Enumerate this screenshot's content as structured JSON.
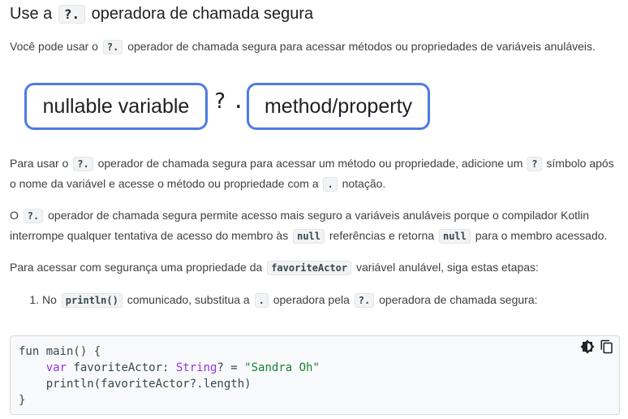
{
  "heading": {
    "pre": "Use a",
    "code": "?.",
    "post": "operadora de chamada segura"
  },
  "intro": {
    "pre": "Você pode usar o",
    "code": "?.",
    "post": "operador de chamada segura para acessar métodos ou propriedades de variáveis anuláveis."
  },
  "diagram": {
    "left": "nullable variable",
    "q": "?",
    "dot": ".",
    "right": "method/property"
  },
  "para2": {
    "t1": "Para usar o",
    "c1": "?.",
    "t2": "operador de chamada segura para acessar um método ou propriedade, adicione um",
    "c2": "?",
    "t3": "símbolo após o nome da variável e acesse o método ou propriedade com a",
    "c3": ".",
    "t4": "notação."
  },
  "para3": {
    "t1": "O",
    "c1": "?.",
    "t2": "operador de chamada segura permite acesso mais seguro a variáveis anuláveis porque o compilador Kotlin interrompe qualquer tentativa de acesso do membro às",
    "c2": "null",
    "t3": "referências e retorna",
    "c3": "null",
    "t4": "para o membro acessado."
  },
  "para4": {
    "t1": "Para acessar com segurança uma propriedade da",
    "c1": "favoriteActor",
    "t2": "variável anulável, siga estas etapas:"
  },
  "step1": {
    "t1": "No",
    "c1": "println()",
    "t2": "comunicado, substitua a",
    "c2": ".",
    "t3": "operadora pela",
    "c3": "?.",
    "t4": "operadora de chamada segura:"
  },
  "code": {
    "l1": "fun main() {",
    "l2_indent": "    ",
    "l2_kw": "var",
    "l2_name": " favoriteActor: ",
    "l2_type": "String",
    "l2_mid": "? = ",
    "l2_str": "\"Sandra Oh\"",
    "l3": "    println(favoriteActor?.length)",
    "l4": "}"
  },
  "icons": {
    "theme": "dark-theme-toggle-icon",
    "copy": "copy-icon"
  }
}
